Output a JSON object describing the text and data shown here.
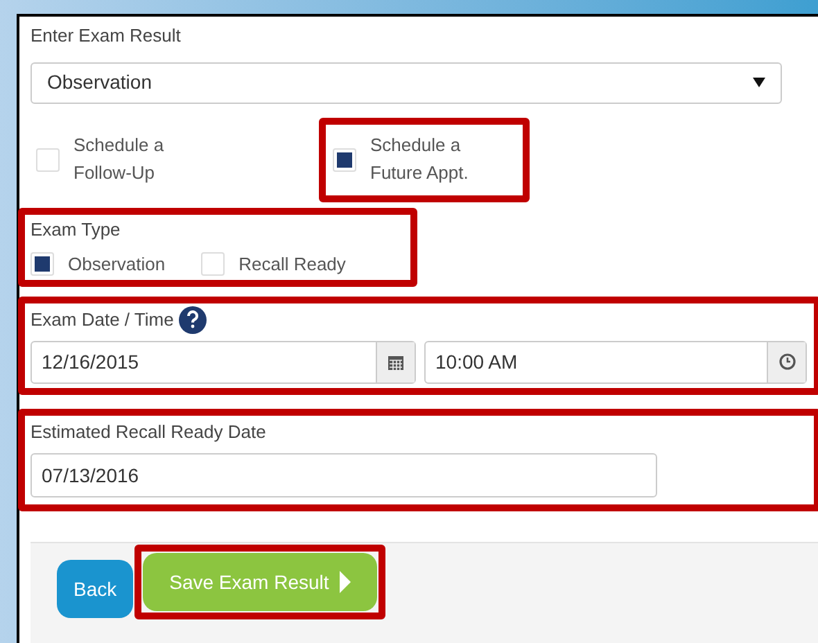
{
  "form": {
    "title": "Enter Exam Result",
    "result_select": {
      "value": "Observation"
    },
    "schedule_options": [
      {
        "label": "Schedule a Follow-Up",
        "checked": false,
        "highlighted": false
      },
      {
        "label": "Schedule a Future Appt.",
        "checked": true,
        "highlighted": true
      }
    ],
    "exam_type": {
      "label": "Exam Type",
      "highlighted": true,
      "options": [
        {
          "label": "Observation",
          "checked": true
        },
        {
          "label": "Recall Ready",
          "checked": false
        }
      ]
    },
    "exam_date_time": {
      "label": "Exam Date / Time",
      "highlighted": true,
      "date": "12/16/2015",
      "time": "10:00 AM"
    },
    "recall_date": {
      "label": "Estimated Recall Ready Date",
      "highlighted": true,
      "value": "07/13/2016"
    },
    "buttons": [
      {
        "label": "Back",
        "kind": "back",
        "highlighted": false
      },
      {
        "label": "Save Exam Result",
        "kind": "save",
        "highlighted": true
      }
    ]
  }
}
